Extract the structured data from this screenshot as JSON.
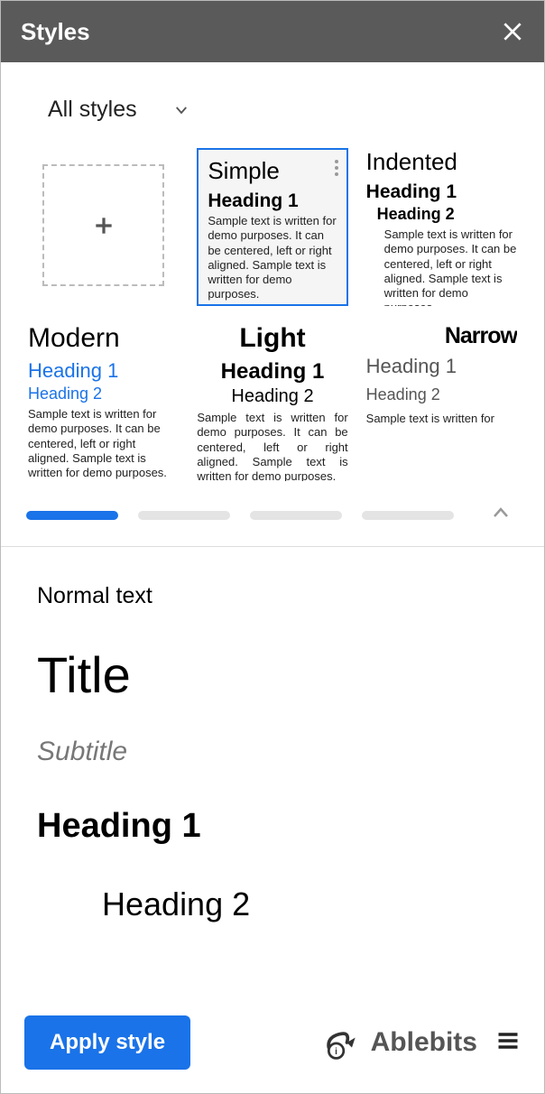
{
  "header": {
    "title": "Styles"
  },
  "filter": {
    "label": "All styles"
  },
  "sample_text": "Sample text is written for demo purposes. It can be centered, left or right aligned. Sample text is written for demo purposes.",
  "sample_text_short": "Sample text is written for",
  "cards": {
    "simple": {
      "title": "Simple",
      "h1": "Heading 1"
    },
    "indented": {
      "title": "Indented",
      "h1": "Heading 1",
      "h2": "Heading 2"
    },
    "modern": {
      "title": "Modern",
      "h1": "Heading 1",
      "h2": "Heading 2"
    },
    "light": {
      "title": "Light",
      "h1": "Heading 1",
      "h2": "Heading 2"
    },
    "narrow": {
      "title": "Narrow",
      "h1": "Heading 1",
      "h2": "Heading 2"
    }
  },
  "pager": {
    "active": 0,
    "count": 4
  },
  "preview": {
    "normal": "Normal text",
    "title": "Title",
    "subtitle": "Subtitle",
    "h1": "Heading 1",
    "h2": "Heading 2"
  },
  "footer": {
    "apply_label": "Apply style",
    "brand": "Ablebits"
  }
}
